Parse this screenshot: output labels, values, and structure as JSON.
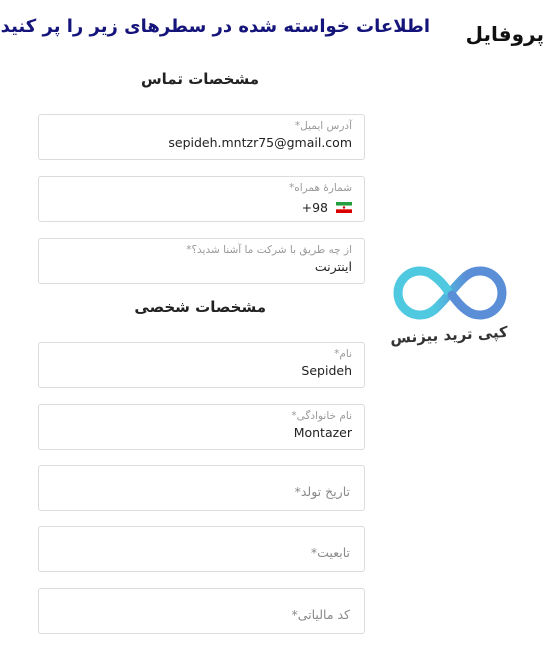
{
  "header": {
    "profile_title": "پروفایل",
    "instructions": "اطلاعات خواسته شده در سطرهای زیر را پر کنید"
  },
  "contact_section": {
    "title": "مشخصات تماس",
    "email": {
      "label": "آدرس ایمیل*",
      "value": "sepideh.mntzr75@gmail.com"
    },
    "phone": {
      "label": "شمارهٔ همراه*",
      "country_code": "+98",
      "flag": "iran-flag-icon"
    },
    "referral": {
      "label": "از چه طریق با شرکت ما آشنا شدید؟*",
      "value": "اینترنت"
    }
  },
  "personal_section": {
    "title": "مشخصات شخصی",
    "first_name": {
      "label": "نام*",
      "value": "Sepideh"
    },
    "last_name": {
      "label": "نام خانوادگی*",
      "value": "Montazer"
    },
    "birth_date": {
      "placeholder": "تاریخ تولد*"
    },
    "nationality": {
      "placeholder": "تابعیت*"
    },
    "tax_code": {
      "placeholder": "کد مالیاتی*"
    }
  },
  "brand": {
    "name": "کپی ترید بیزنس",
    "logo_icon": "infinity-logo-icon",
    "colors": {
      "cyan": "#4fc9e0",
      "blue": "#5a8fd8"
    }
  },
  "colors": {
    "instructions_text": "#14147a",
    "field_border": "#dcdcdc",
    "label_text": "#9a9a9a"
  }
}
